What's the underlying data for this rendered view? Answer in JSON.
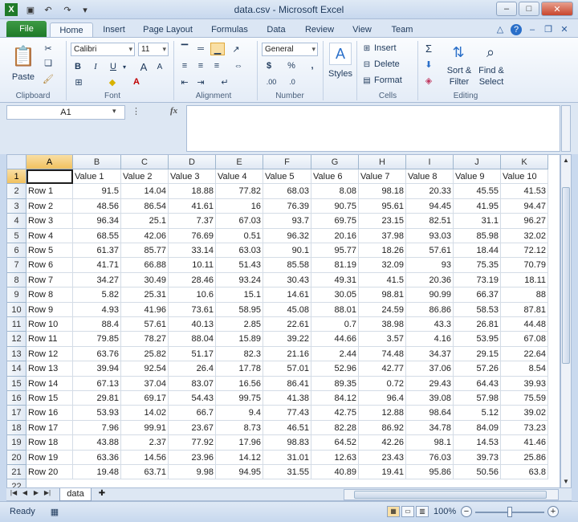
{
  "window": {
    "title": "data.csv - Microsoft Excel"
  },
  "ribbon": {
    "tabs": [
      "File",
      "Home",
      "Insert",
      "Page Layout",
      "Formulas",
      "Data",
      "Review",
      "View",
      "Team"
    ],
    "active_tab": "Home",
    "clipboard": {
      "paste": "Paste",
      "label": "Clipboard"
    },
    "font": {
      "name": "Calibri",
      "size": "11",
      "bold": "B",
      "italic": "I",
      "underline": "U",
      "grow": "A",
      "shrink": "A",
      "label": "Font"
    },
    "alignment": {
      "label": "Alignment"
    },
    "number": {
      "format": "General",
      "currency": "$",
      "percent": "%",
      "comma": ",",
      "label": "Number"
    },
    "styles": {
      "label": "Styles"
    },
    "cells": {
      "insert": "Insert",
      "delete": "Delete",
      "format": "Format",
      "label": "Cells"
    },
    "editing": {
      "sum": "Σ",
      "sort": "Sort &",
      "sort2": "Filter",
      "find": "Find &",
      "find2": "Select",
      "label": "Editing"
    }
  },
  "formula_bar": {
    "name_box": "A1",
    "fx": "fx",
    "content": ""
  },
  "grid": {
    "columns": [
      "A",
      "B",
      "C",
      "D",
      "E",
      "F",
      "G",
      "H",
      "I",
      "J",
      "K"
    ],
    "header_row": [
      "",
      "Value 1",
      "Value 2",
      "Value 3",
      "Value 4",
      "Value 5",
      "Value 6",
      "Value 7",
      "Value 8",
      "Value 9",
      "Value 10"
    ],
    "rows": [
      [
        "Row 1",
        "91.5",
        "14.04",
        "18.88",
        "77.82",
        "68.03",
        "8.08",
        "98.18",
        "20.33",
        "45.55",
        "41.53"
      ],
      [
        "Row 2",
        "48.56",
        "86.54",
        "41.61",
        "16",
        "76.39",
        "90.75",
        "95.61",
        "94.45",
        "41.95",
        "94.47"
      ],
      [
        "Row 3",
        "96.34",
        "25.1",
        "7.37",
        "67.03",
        "93.7",
        "69.75",
        "23.15",
        "82.51",
        "31.1",
        "96.27"
      ],
      [
        "Row 4",
        "68.55",
        "42.06",
        "76.69",
        "0.51",
        "96.32",
        "20.16",
        "37.98",
        "93.03",
        "85.98",
        "32.02"
      ],
      [
        "Row 5",
        "61.37",
        "85.77",
        "33.14",
        "63.03",
        "90.1",
        "95.77",
        "18.26",
        "57.61",
        "18.44",
        "72.12"
      ],
      [
        "Row 6",
        "41.71",
        "66.88",
        "10.11",
        "51.43",
        "85.58",
        "81.19",
        "32.09",
        "93",
        "75.35",
        "70.79"
      ],
      [
        "Row 7",
        "34.27",
        "30.49",
        "28.46",
        "93.24",
        "30.43",
        "49.31",
        "41.5",
        "20.36",
        "73.19",
        "18.11"
      ],
      [
        "Row 8",
        "5.82",
        "25.31",
        "10.6",
        "15.1",
        "14.61",
        "30.05",
        "98.81",
        "90.99",
        "66.37",
        "88"
      ],
      [
        "Row 9",
        "4.93",
        "41.96",
        "73.61",
        "58.95",
        "45.08",
        "88.01",
        "24.59",
        "86.86",
        "58.53",
        "87.81"
      ],
      [
        "Row 10",
        "88.4",
        "57.61",
        "40.13",
        "2.85",
        "22.61",
        "0.7",
        "38.98",
        "43.3",
        "26.81",
        "44.48"
      ],
      [
        "Row 11",
        "79.85",
        "78.27",
        "88.04",
        "15.89",
        "39.22",
        "44.66",
        "3.57",
        "4.16",
        "53.95",
        "67.08"
      ],
      [
        "Row 12",
        "63.76",
        "25.82",
        "51.17",
        "82.3",
        "21.16",
        "2.44",
        "74.48",
        "34.37",
        "29.15",
        "22.64"
      ],
      [
        "Row 13",
        "39.94",
        "92.54",
        "26.4",
        "17.78",
        "57.01",
        "52.96",
        "42.77",
        "37.06",
        "57.26",
        "8.54"
      ],
      [
        "Row 14",
        "67.13",
        "37.04",
        "83.07",
        "16.56",
        "86.41",
        "89.35",
        "0.72",
        "29.43",
        "64.43",
        "39.93"
      ],
      [
        "Row 15",
        "29.81",
        "69.17",
        "54.43",
        "99.75",
        "41.38",
        "84.12",
        "96.4",
        "39.08",
        "57.98",
        "75.59"
      ],
      [
        "Row 16",
        "53.93",
        "14.02",
        "66.7",
        "9.4",
        "77.43",
        "42.75",
        "12.88",
        "98.64",
        "5.12",
        "39.02"
      ],
      [
        "Row 17",
        "7.96",
        "99.91",
        "23.67",
        "8.73",
        "46.51",
        "82.28",
        "86.92",
        "34.78",
        "84.09",
        "73.23"
      ],
      [
        "Row 18",
        "43.88",
        "2.37",
        "77.92",
        "17.96",
        "98.83",
        "64.52",
        "42.26",
        "98.1",
        "14.53",
        "41.46"
      ],
      [
        "Row 19",
        "63.36",
        "14.56",
        "23.96",
        "14.12",
        "31.01",
        "12.63",
        "23.43",
        "76.03",
        "39.73",
        "25.86"
      ],
      [
        "Row 20",
        "19.48",
        "63.71",
        "9.98",
        "94.95",
        "31.55",
        "40.89",
        "19.41",
        "95.86",
        "50.56",
        "63.8"
      ]
    ],
    "partial_row_label": "22"
  },
  "sheets": {
    "tabs": [
      "data"
    ]
  },
  "status": {
    "mode": "Ready",
    "zoom": "100%",
    "zoom_out": "−",
    "zoom_in": "+"
  }
}
